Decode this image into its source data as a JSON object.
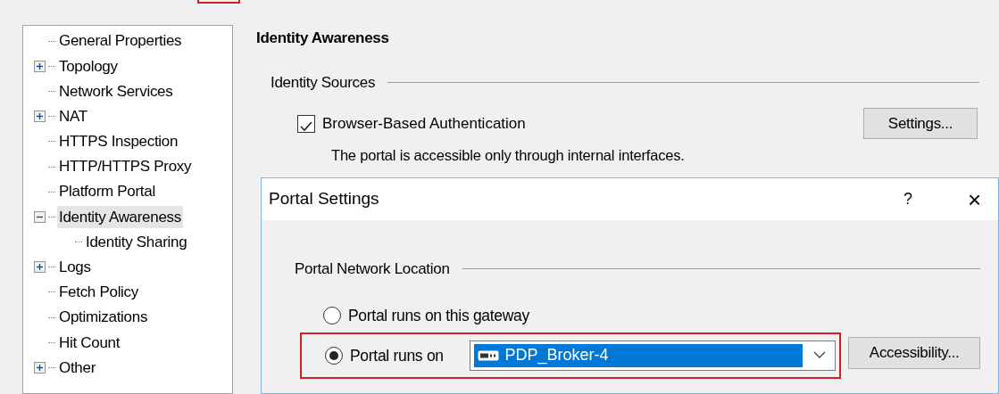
{
  "tree": [
    {
      "label": "General Properties",
      "kind": "leaf",
      "selected": false
    },
    {
      "label": "Topology",
      "kind": "node",
      "expanded": false,
      "selected": false
    },
    {
      "label": "Network Services",
      "kind": "leaf",
      "selected": false
    },
    {
      "label": "NAT",
      "kind": "node",
      "expanded": false,
      "selected": false
    },
    {
      "label": "HTTPS Inspection",
      "kind": "leaf",
      "selected": false
    },
    {
      "label": "HTTP/HTTPS Proxy",
      "kind": "leaf",
      "selected": false
    },
    {
      "label": "Platform Portal",
      "kind": "leaf",
      "selected": false
    },
    {
      "label": "Identity Awareness",
      "kind": "node",
      "expanded": true,
      "selected": true,
      "children": [
        {
          "label": "Identity Sharing",
          "selected": false
        }
      ]
    },
    {
      "label": "Logs",
      "kind": "node",
      "expanded": false,
      "selected": false
    },
    {
      "label": "Fetch Policy",
      "kind": "leaf",
      "selected": false
    },
    {
      "label": "Optimizations",
      "kind": "leaf",
      "selected": false
    },
    {
      "label": "Hit Count",
      "kind": "leaf",
      "selected": false
    },
    {
      "label": "Other",
      "kind": "node",
      "expanded": false,
      "selected": false
    }
  ],
  "page": {
    "title": "Identity Awareness",
    "group": "Identity Sources",
    "checkbox": {
      "label": "Browser-Based Authentication",
      "checked": true
    },
    "settings_button": "Settings...",
    "note": "The portal is accessible only through internal interfaces."
  },
  "dialog": {
    "title": "Portal Settings",
    "help": "?",
    "close": "×",
    "group": "Portal Network Location",
    "options": [
      {
        "label": "Portal runs on this gateway",
        "selected": false
      },
      {
        "label": "Portal runs on",
        "selected": true,
        "combo_value": "PDP_Broker-4",
        "button": "Accessibility..."
      }
    ]
  }
}
